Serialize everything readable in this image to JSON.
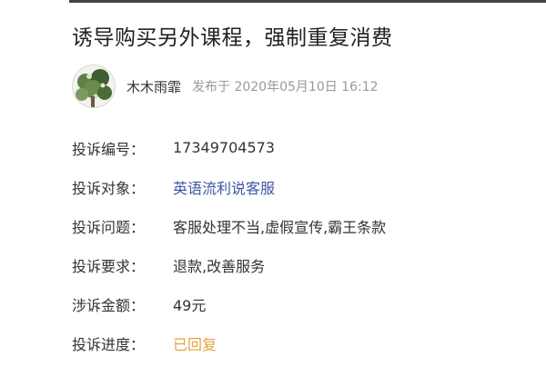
{
  "complaint": {
    "title": "诱导购买另外课程，强制重复消费",
    "author": {
      "name": "木木雨霏",
      "posted_at": "发布于 2020年05月10日 16:12",
      "avatar_icon": "avatar-photo-icon"
    },
    "fields": [
      {
        "label": "投诉编号：",
        "value": "17349704573"
      },
      {
        "label": "投诉对象：",
        "value": "英语流利说客服"
      },
      {
        "label": "投诉问题：",
        "value": "客服处理不当,虚假宣传,霸王条款"
      },
      {
        "label": "投诉要求：",
        "value": "退款,改善服务"
      },
      {
        "label": "涉诉金额：",
        "value": "49元"
      },
      {
        "label": "投诉进度：",
        "value": "已回复"
      }
    ]
  },
  "colors": {
    "link": "#3a56a6",
    "status": "#e6a23c",
    "muted": "#999999",
    "text": "#333333"
  }
}
